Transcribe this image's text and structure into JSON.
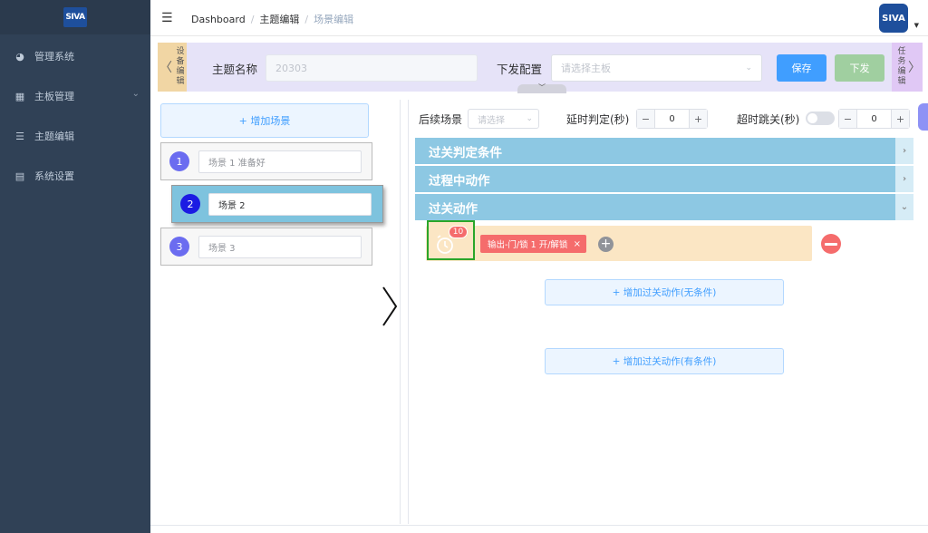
{
  "brand": {
    "logo_text": "SIVA"
  },
  "sidebar": {
    "items": [
      {
        "label": "管理系统",
        "icon": "dashboard-icon"
      },
      {
        "label": "主板管理",
        "icon": "grid-icon"
      },
      {
        "label": "主题编辑",
        "icon": "list-icon"
      },
      {
        "label": "系统设置",
        "icon": "settings-doc-icon"
      }
    ]
  },
  "header": {
    "breadcrumbs": [
      "Dashboard",
      "主题编辑",
      "场景编辑"
    ],
    "avatar_text": "SIVA"
  },
  "topbar": {
    "left_tab": "设备编辑",
    "right_tab": "任务编辑",
    "theme_name_label": "主题名称",
    "theme_name_value": "20303",
    "config_label": "下发配置",
    "config_placeholder": "请选择主板",
    "save_label": "保存",
    "send_label": "下发"
  },
  "scenes": {
    "add_label": "+ 增加场景",
    "items": [
      {
        "num": "1",
        "name": "场景 1 准备好",
        "color": "#6b6cf0"
      },
      {
        "num": "2",
        "name": "场景 2",
        "color": "#1b1be3"
      },
      {
        "num": "3",
        "name": "场景 3",
        "color": "#6b6cf0"
      }
    ]
  },
  "settings": {
    "next_scene_label": "后续场景",
    "next_scene_placeholder": "请选择",
    "delay_label": "延时判定(秒)",
    "delay_value": "0",
    "timeout_label": "超时跳关(秒)",
    "timeout_value": "0",
    "minus": "−",
    "plus": "+"
  },
  "sections": [
    {
      "title": "过关判定条件",
      "chevron": "›"
    },
    {
      "title": "过程中动作",
      "chevron": "›"
    },
    {
      "title": "过关动作",
      "chevron": "⌄"
    }
  ],
  "action": {
    "timer_badge": "10",
    "tag_label": "输出-门/锁 1 开/解锁",
    "tag_close": "×",
    "add": "+"
  },
  "add_actions": {
    "no_condition": "+ 增加过关动作(无条件)",
    "with_condition": "+ 增加过关动作(有条件)"
  },
  "colors": {
    "sidebar_bg": "#304156",
    "accent": "#409eff",
    "section_bg": "#8dc8e3",
    "danger": "#f56c6c"
  }
}
